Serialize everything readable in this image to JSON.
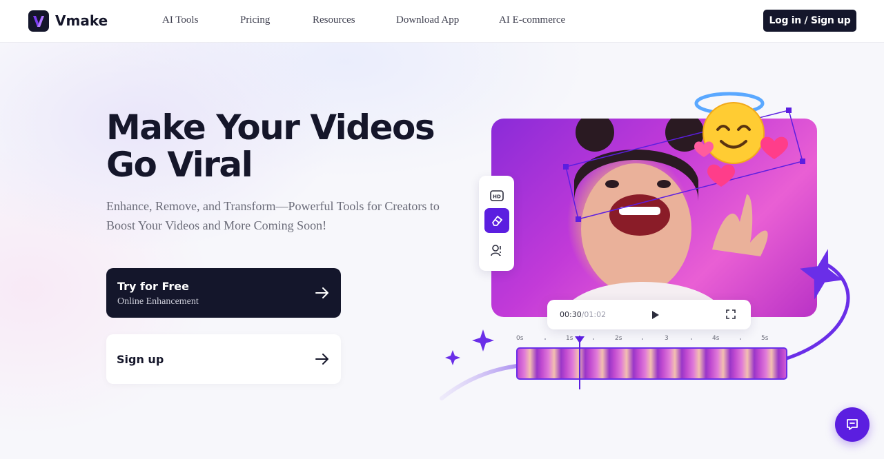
{
  "header": {
    "brand": "Vmake",
    "nav": [
      {
        "label": "AI Tools"
      },
      {
        "label": "Pricing"
      },
      {
        "label": "Resources"
      },
      {
        "label": "Download App"
      },
      {
        "label": "AI E-commerce"
      }
    ],
    "login_label": "Log in / Sign up"
  },
  "hero": {
    "title_line1": "Make Your Videos",
    "title_line2": "Go Viral",
    "subtitle": "Enhance, Remove, and Transform—Powerful Tools for Creators to Boost Your Videos and More Coming Soon!",
    "try_button": {
      "title": "Try for Free",
      "subtitle": "Online Enhancement"
    },
    "signup_label": "Sign up"
  },
  "player": {
    "current_time": "00:30",
    "total_time": "01:02",
    "timeline_ticks": [
      "0s",
      "1s",
      "2s",
      "3",
      "4s",
      "5s"
    ]
  },
  "tools": [
    "hd-icon",
    "eraser-icon",
    "face-swap-icon"
  ],
  "colors": {
    "accent": "#5b1ee0",
    "dark": "#14162b",
    "text_muted": "#6a6b78"
  }
}
